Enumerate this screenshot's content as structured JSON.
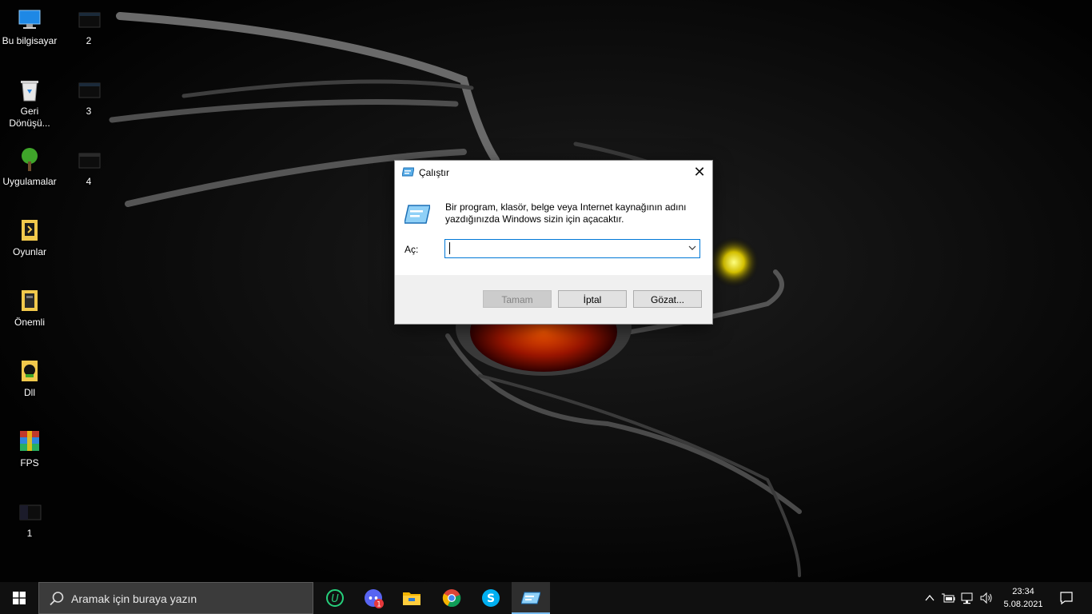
{
  "desktop": {
    "icons": [
      {
        "label": "Bu bilgisayar"
      },
      {
        "label": "Geri Dönüşü..."
      },
      {
        "label": "Uygulamalar"
      },
      {
        "label": "Oyunlar"
      },
      {
        "label": "Önemli"
      },
      {
        "label": "Dll"
      },
      {
        "label": "FPS"
      },
      {
        "label": "1"
      },
      {
        "label": "2"
      },
      {
        "label": "3"
      },
      {
        "label": "4"
      }
    ]
  },
  "run_dialog": {
    "title": "Çalıştır",
    "description": "Bir program, klasör, belge veya Internet kaynağının adını yazdığınızda Windows sizin için açacaktır.",
    "open_label": "Aç:",
    "open_value": "",
    "ok_label": "Tamam",
    "cancel_label": "İptal",
    "browse_label": "Gözat..."
  },
  "taskbar": {
    "search_placeholder": "Aramak için buraya yazın",
    "apps": [
      {
        "icon": "ubisoft-connect-icon"
      },
      {
        "icon": "discord-icon",
        "badge": "1"
      },
      {
        "icon": "file-explorer-icon"
      },
      {
        "icon": "chrome-icon"
      },
      {
        "icon": "skype-icon"
      },
      {
        "icon": "run-icon",
        "active": true
      }
    ],
    "clock": {
      "time": "23:34",
      "date": "5.08.2021"
    }
  },
  "colors": {
    "taskbar_bg": "#101010",
    "accent": "#0078d7",
    "dialog_footer": "#f0f0f0"
  }
}
